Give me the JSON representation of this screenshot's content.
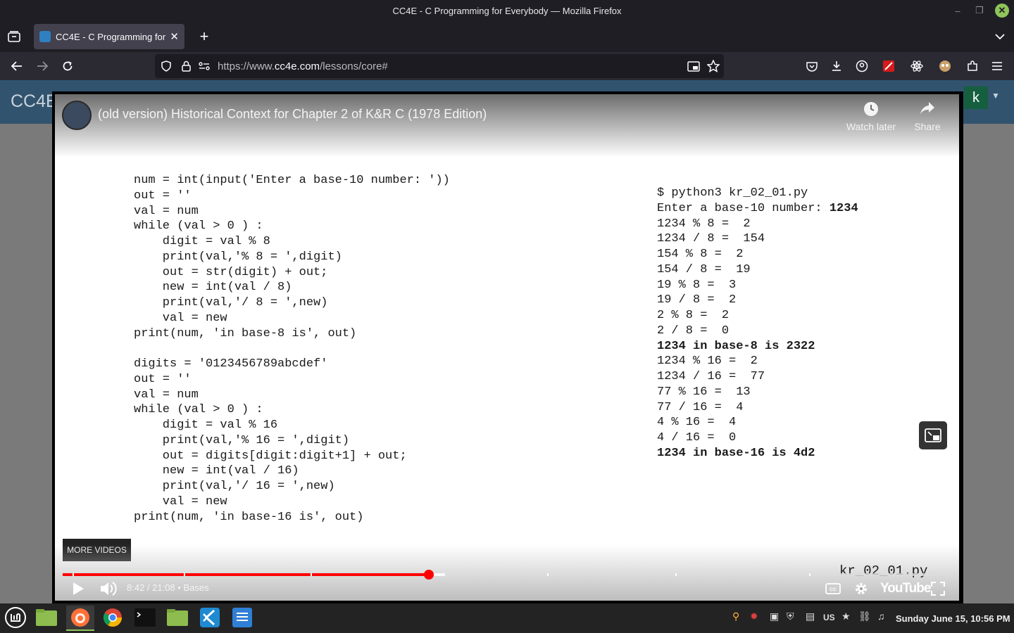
{
  "window": {
    "title": "CC4E - C Programming for Everybody — Mozilla Firefox"
  },
  "tab": {
    "title": "CC4E - C Programming for E"
  },
  "url": {
    "prefix": "https://www.",
    "domain": "cc4e.com",
    "path": "/lessons/core#"
  },
  "site": {
    "brand": "CC4E",
    "user_initial": "k"
  },
  "video": {
    "title": "(old version) Historical Context for Chapter 2 of K&R C (1978 Edition)",
    "watch_later": "Watch later",
    "share": "Share",
    "more_videos": "MORE VIDEOS",
    "time": "8:42 / 21:08",
    "chapter": "Bases",
    "filename": "kr_02_01.py",
    "logo": "YouTube",
    "progress_fraction": 0.412,
    "buffered_fraction": 0.43
  },
  "code_left": [
    "num = int(input('Enter a base-10 number: '))",
    "out = ''",
    "val = num",
    "while (val > 0 ) :",
    "    digit = val % 8",
    "    print(val,'% 8 = ',digit)",
    "    out = str(digit) + out;",
    "    new = int(val / 8)",
    "    print(val,'/ 8 = ',new)",
    "    val = new",
    "print(num, 'in base-8 is', out)",
    "",
    "digits = '0123456789abcdef'",
    "out = ''",
    "val = num",
    "while (val > 0 ) :",
    "    digit = val % 16",
    "    print(val,'% 16 = ',digit)",
    "    out = digits[digit:digit+1] + out;",
    "    new = int(val / 16)",
    "    print(val,'/ 16 = ',new)",
    "    val = new",
    "print(num, 'in base-16 is', out)"
  ],
  "code_right": [
    {
      "text": "$ python3 kr_02_01.py",
      "bold": false
    },
    {
      "text": "Enter a base-10 number: ",
      "bold": false,
      "bold_tail": "1234"
    },
    {
      "text": "1234 % 8 =  2",
      "bold": false
    },
    {
      "text": "1234 / 8 =  154",
      "bold": false
    },
    {
      "text": "154 % 8 =  2",
      "bold": false
    },
    {
      "text": "154 / 8 =  19",
      "bold": false
    },
    {
      "text": "19 % 8 =  3",
      "bold": false
    },
    {
      "text": "19 / 8 =  2",
      "bold": false
    },
    {
      "text": "2 % 8 =  2",
      "bold": false
    },
    {
      "text": "2 / 8 =  0",
      "bold": false
    },
    {
      "text": "1234 in base-8 is 2322",
      "bold": true
    },
    {
      "text": "1234 % 16 =  2",
      "bold": false
    },
    {
      "text": "1234 / 16 =  77",
      "bold": false
    },
    {
      "text": "77 % 16 =  13",
      "bold": false
    },
    {
      "text": "77 / 16 =  4",
      "bold": false
    },
    {
      "text": "4 % 16 =  4",
      "bold": false
    },
    {
      "text": "4 / 16 =  0",
      "bold": false
    },
    {
      "text": "1234 in base-16 is 4d2",
      "bold": true
    }
  ],
  "taskbar": {
    "keyboard_layout": "US",
    "clock": "Sunday June 15, 10:56 PM"
  }
}
